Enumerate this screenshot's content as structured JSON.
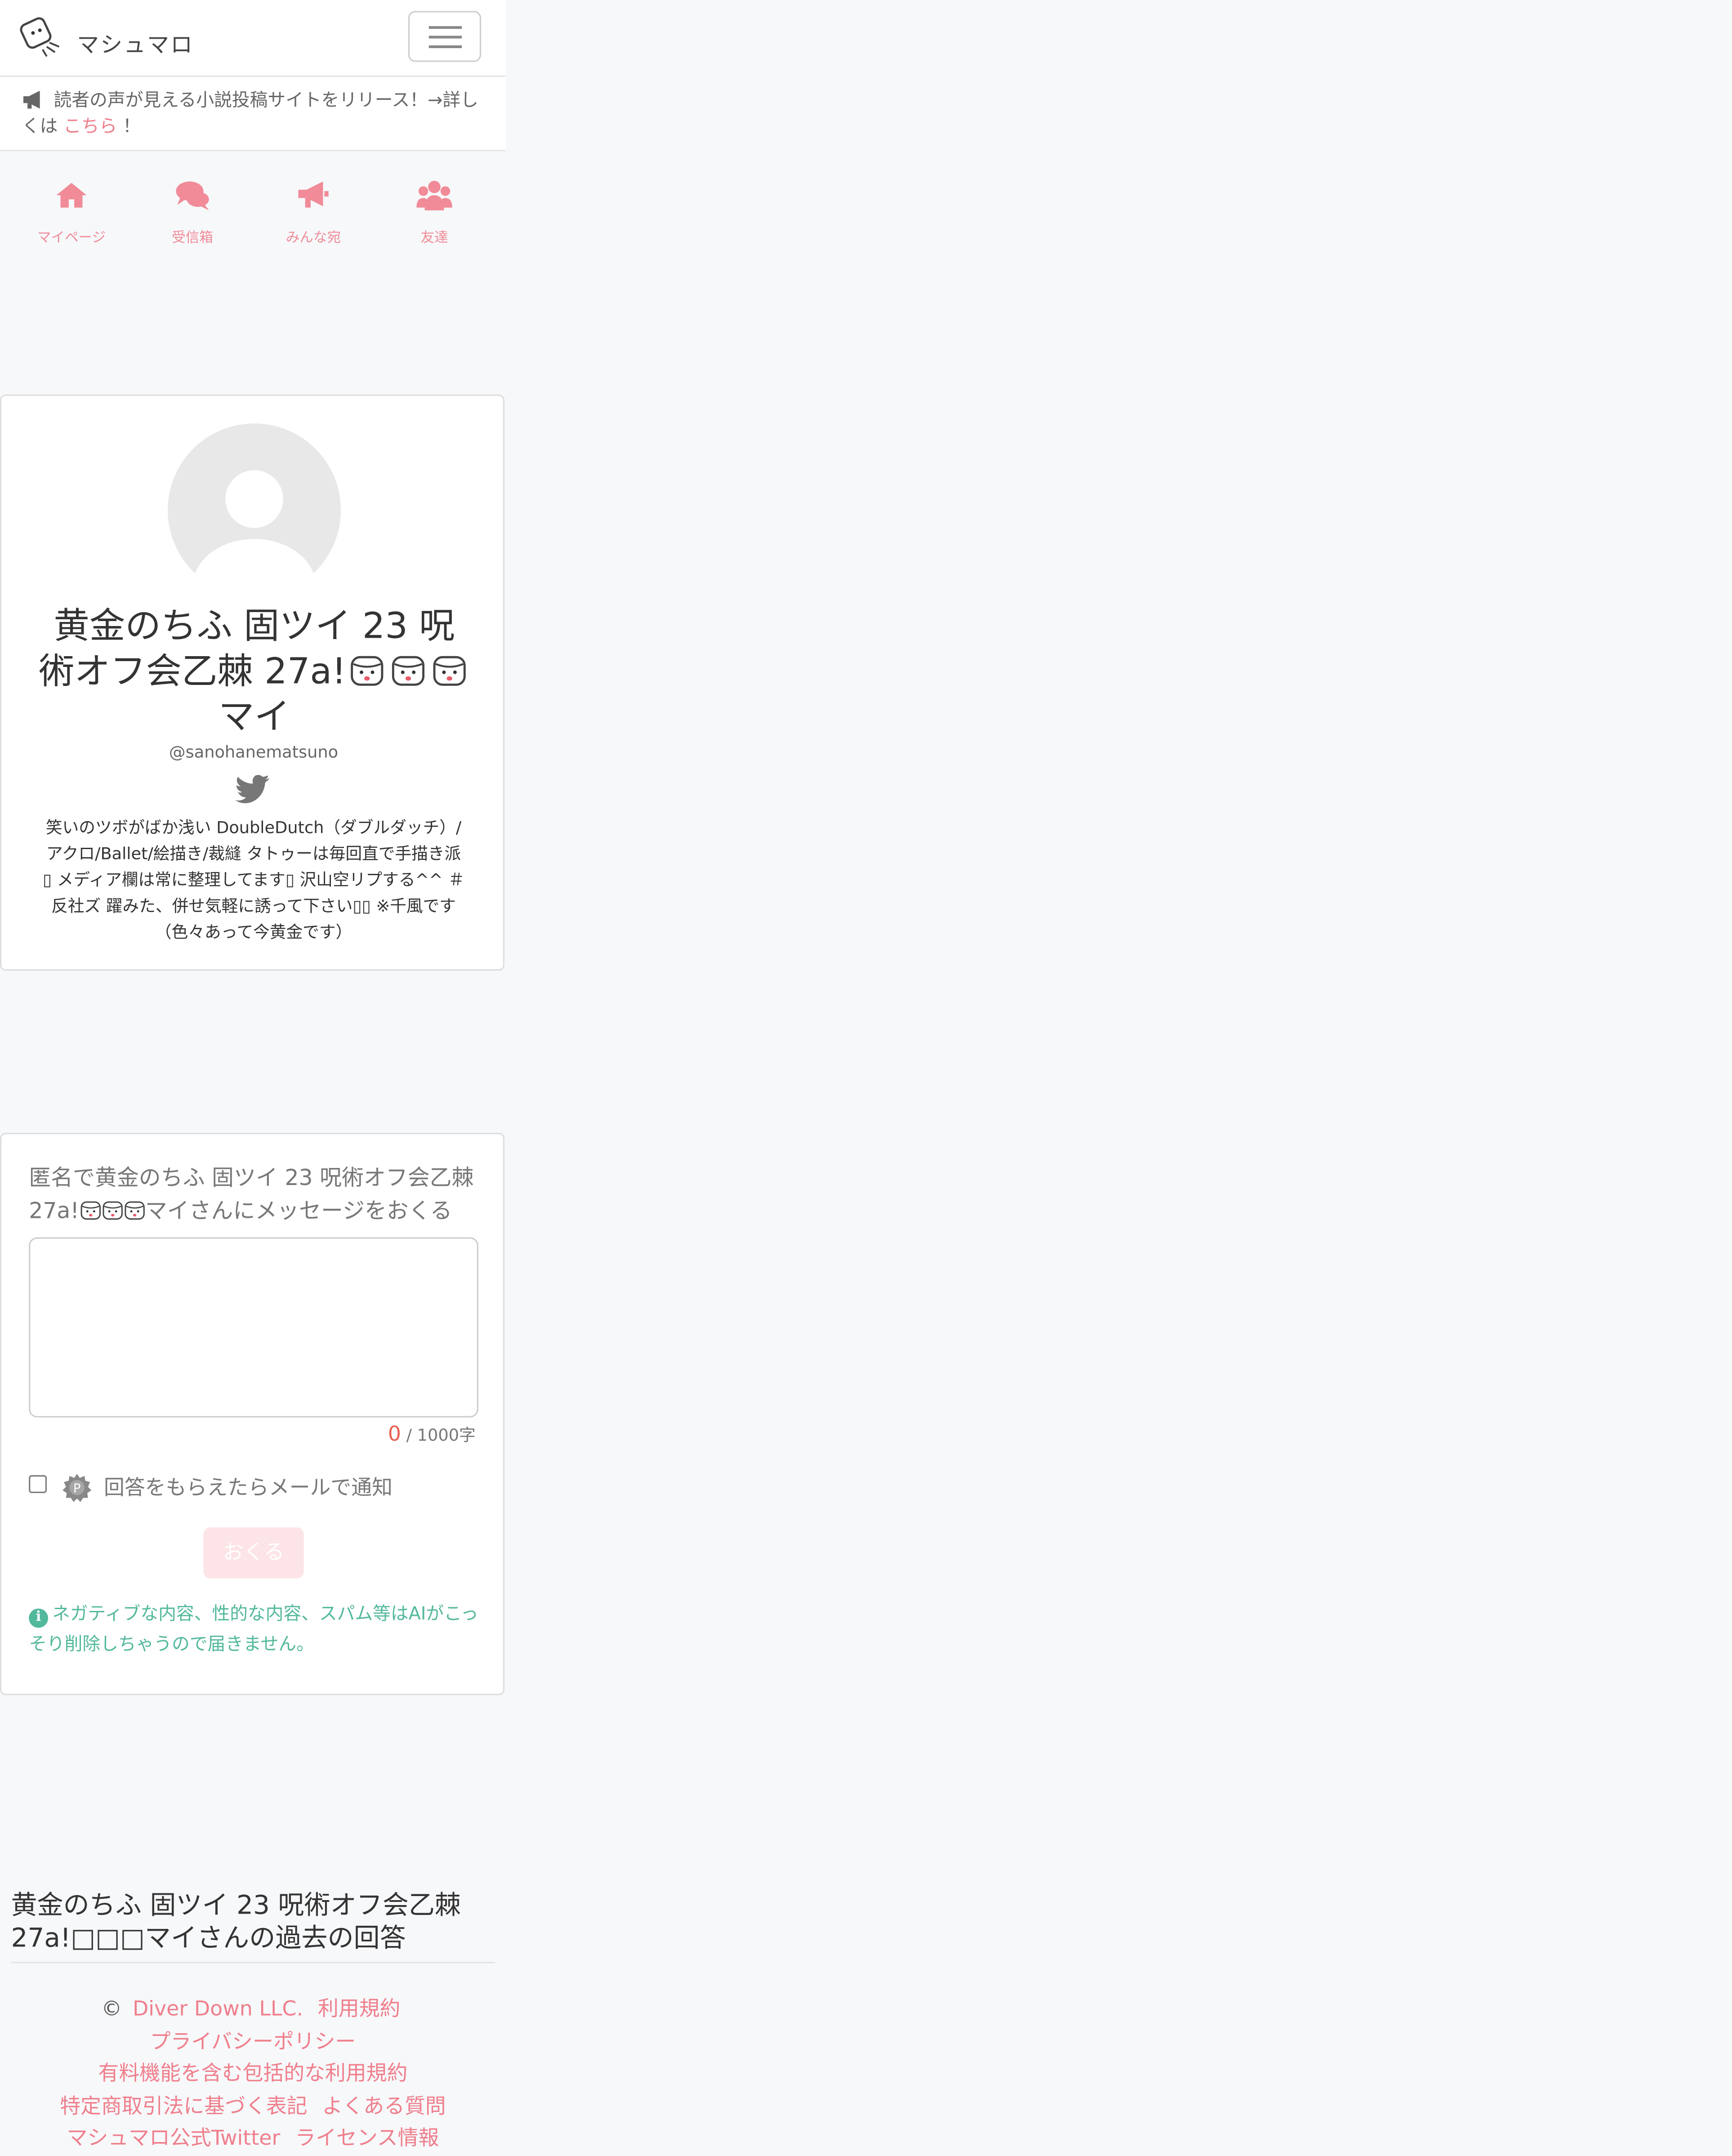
{
  "header": {
    "brand": "マシュマロ"
  },
  "announcement": {
    "text": "読者の声が見える小説投稿サイトをリリース！→詳しくは",
    "link": "こちら",
    "suffix": "！"
  },
  "nav": {
    "items": [
      {
        "label": "マイページ",
        "icon": "home-icon"
      },
      {
        "label": "受信箱",
        "icon": "chat-icon"
      },
      {
        "label": "みんな宛",
        "icon": "megaphone-icon"
      },
      {
        "label": "友達",
        "icon": "users-icon"
      }
    ]
  },
  "profile": {
    "name_line1": "黄金のちふ 固ツイ 23 呪",
    "name_line2": "術オフ会乙棘 27a!",
    "name_line3": "マイ",
    "handle": "@sanohanematsuno",
    "bio": "笑いのツボがばか浅い DoubleDutch（ダブルダッチ）/アクロ/Ballet/絵描き/裁縫 タトゥーは毎回直で手描き派▯ メディア欄は常に整理してます▯ 沢山空リプする^^ ＃反社ズ 躍みた、併せ気軽に誘って下さい▯▯ ※千風です（色々あって今黄金です）"
  },
  "message": {
    "prompt_line1": "匿名で黄金のちふ 固ツイ 23 呪術オフ会乙棘",
    "prompt_line2_start": "27a!",
    "prompt_line2_end": "マイさんにメッセージをおくる",
    "count": "0",
    "limit": " / 1000字",
    "notify_label": "回答をもらえたらメールで通知",
    "send_label": "おくる",
    "notice": "ネガティブな内容、性的な内容、スパム等はAIがこっそり削除しちゃうので届きません。"
  },
  "past": {
    "title": "黄金のちふ 固ツイ 23 呪術オフ会乙棘 27a!□□□マイさんの過去の回答"
  },
  "footer": {
    "copyright": "©",
    "company": "Diver Down LLC.",
    "terms": "利用規約",
    "privacy": "プライバシーポリシー",
    "paid_terms": "有料機能を含む包括的な利用規約",
    "commerce": "特定商取引法に基づく表記",
    "faq": "よくある質問",
    "twitter": "マシュマロ公式Twitter",
    "license": "ライセンス情報"
  },
  "colors": {
    "accent": "#ef7f8c",
    "notice": "#52b89c",
    "background": "#f7f8fa"
  }
}
